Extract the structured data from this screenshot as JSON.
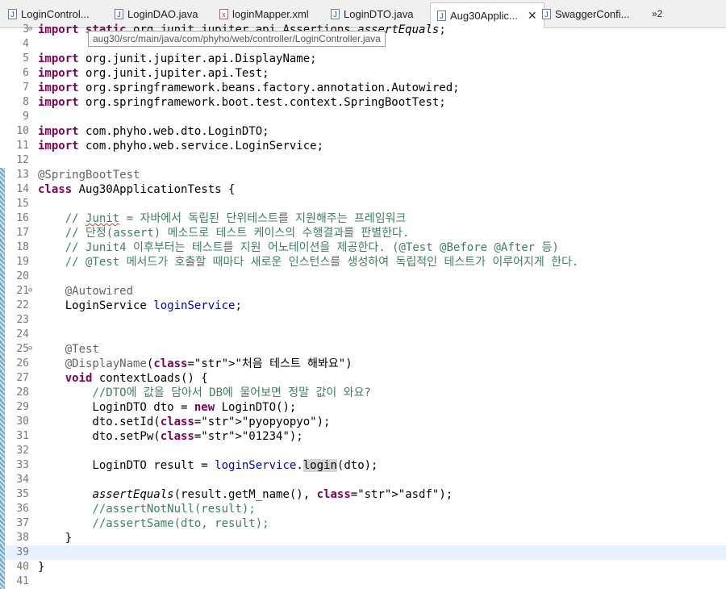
{
  "tabs": [
    {
      "label": "LoginControl...",
      "icon": "java-file-icon",
      "active": false
    },
    {
      "label": "LoginDAO.java",
      "icon": "java-file-icon",
      "active": false
    },
    {
      "label": "loginMapper.xml",
      "icon": "xml-file-icon",
      "active": false
    },
    {
      "label": "LoginDTO.java",
      "icon": "java-file-icon",
      "active": false
    },
    {
      "label": "Aug30Applic...",
      "icon": "java-file-icon",
      "active": true
    },
    {
      "label": "SwaggerConfi...",
      "icon": "java-file-icon",
      "active": false
    }
  ],
  "tab_overflow": "»2",
  "tooltip": "aug30/src/main/java/com/phyho/web/controller/LoginController.java",
  "current_line": 39,
  "lines": [
    {
      "n": "3",
      "text": "import static org.junit.jupiter.api.Assertions.assertEquals;"
    },
    {
      "n": "4",
      "text": ""
    },
    {
      "n": "5",
      "text": "import org.junit.jupiter.api.DisplayName;"
    },
    {
      "n": "6",
      "text": "import org.junit.jupiter.api.Test;"
    },
    {
      "n": "7",
      "text": "import org.springframework.beans.factory.annotation.Autowired;"
    },
    {
      "n": "8",
      "text": "import org.springframework.boot.test.context.SpringBootTest;"
    },
    {
      "n": "9",
      "text": ""
    },
    {
      "n": "10",
      "text": "import com.phyho.web.dto.LoginDTO;"
    },
    {
      "n": "11",
      "text": "import com.phyho.web.service.LoginService;"
    },
    {
      "n": "12",
      "text": ""
    },
    {
      "n": "13",
      "text": "@SpringBootTest"
    },
    {
      "n": "14",
      "text": "class Aug30ApplicationTests {"
    },
    {
      "n": "15",
      "text": ""
    },
    {
      "n": "16",
      "text": "    // Junit = 자바에서 독립된 단위테스트를 지원해주는 프레임워크"
    },
    {
      "n": "17",
      "text": "    // 단정(assert) 메소드로 테스트 케이스의 수행결과를 판별한다."
    },
    {
      "n": "18",
      "text": "    // Junit4 이후부터는 테스트를 지원 어노테이션을 제공한다. (@Test @Before @After 등)"
    },
    {
      "n": "19",
      "text": "    // @Test 메서드가 호출할 때마다 새로운 인스턴스를 생성하여 독립적인 테스트가 이루어지게 한다."
    },
    {
      "n": "20",
      "text": ""
    },
    {
      "n": "21",
      "text": "    @Autowired"
    },
    {
      "n": "22",
      "text": "    LoginService loginService;"
    },
    {
      "n": "23",
      "text": ""
    },
    {
      "n": "24",
      "text": ""
    },
    {
      "n": "25",
      "text": "    @Test"
    },
    {
      "n": "26",
      "text": "    @DisplayName(\"처음 테스트 해봐요\")"
    },
    {
      "n": "27",
      "text": "    void contextLoads() {"
    },
    {
      "n": "28",
      "text": "        //DTO에 값을 담아서 DB에 물어보면 정말 값이 와요?"
    },
    {
      "n": "29",
      "text": "        LoginDTO dto = new LoginDTO();"
    },
    {
      "n": "30",
      "text": "        dto.setId(\"pyopyopyo\");"
    },
    {
      "n": "31",
      "text": "        dto.setPw(\"01234\");"
    },
    {
      "n": "32",
      "text": ""
    },
    {
      "n": "33",
      "text": "        LoginDTO result = loginService.login(dto);"
    },
    {
      "n": "34",
      "text": ""
    },
    {
      "n": "35",
      "text": "        assertEquals(result.getM_name(), \"asdf\");"
    },
    {
      "n": "36",
      "text": "        //assertNotNull(result);"
    },
    {
      "n": "37",
      "text": "        //assertSame(dto, result);"
    },
    {
      "n": "38",
      "text": "    }"
    },
    {
      "n": "39",
      "text": ""
    },
    {
      "n": "40",
      "text": "}"
    },
    {
      "n": "41",
      "text": ""
    }
  ],
  "colors": {
    "keyword": "#7f0055",
    "string": "#2a00ff",
    "comment": "#3f7f5f",
    "annotation": "#646464",
    "field": "#0000c0"
  }
}
